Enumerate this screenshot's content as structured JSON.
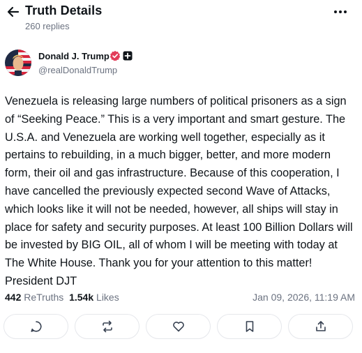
{
  "header": {
    "title": "Truth Details",
    "subtitle": "260 replies"
  },
  "post": {
    "author": {
      "name": "Donald J. Trump",
      "handle": "@realDonaldTrump"
    },
    "text": "Venezuela is releasing large numbers of political prisoners as a sign of “Seeking Peace.” This is a very important and smart gesture. The U.S.A. and Venezuela are working well together, especially as it pertains to rebuilding, in a much bigger, better, and more modern form, their oil and gas infrastructure. Because of this cooperation, I have cancelled the previously expected second Wave of Attacks, which looks like it will not be needed, however, all ships will stay in place for safety and security purposes. At least 100 Billion Dollars will be invested by BIG OIL, all of whom I will be meeting with today at The White House. Thank you for your attention to this matter! President DJT",
    "stats": {
      "retruths_count": "442",
      "retruths_label": "ReTruths",
      "likes_count": "1.54k",
      "likes_label": "Likes",
      "timestamp": "Jan 09, 2026, 11:19 AM"
    }
  },
  "icons": {
    "back": "arrow-left-icon",
    "more": "more-horizontal-icon",
    "verified": "verified-badge-icon",
    "plus": "plus-badge-icon",
    "reply": "reply-icon",
    "retruth": "retruth-icon",
    "like": "heart-icon",
    "bookmark": "bookmark-icon",
    "share": "share-icon"
  },
  "colors": {
    "verified": "#e23b58",
    "text": "#0f1419",
    "muted": "#6b7280",
    "border": "#e5e7eb"
  }
}
